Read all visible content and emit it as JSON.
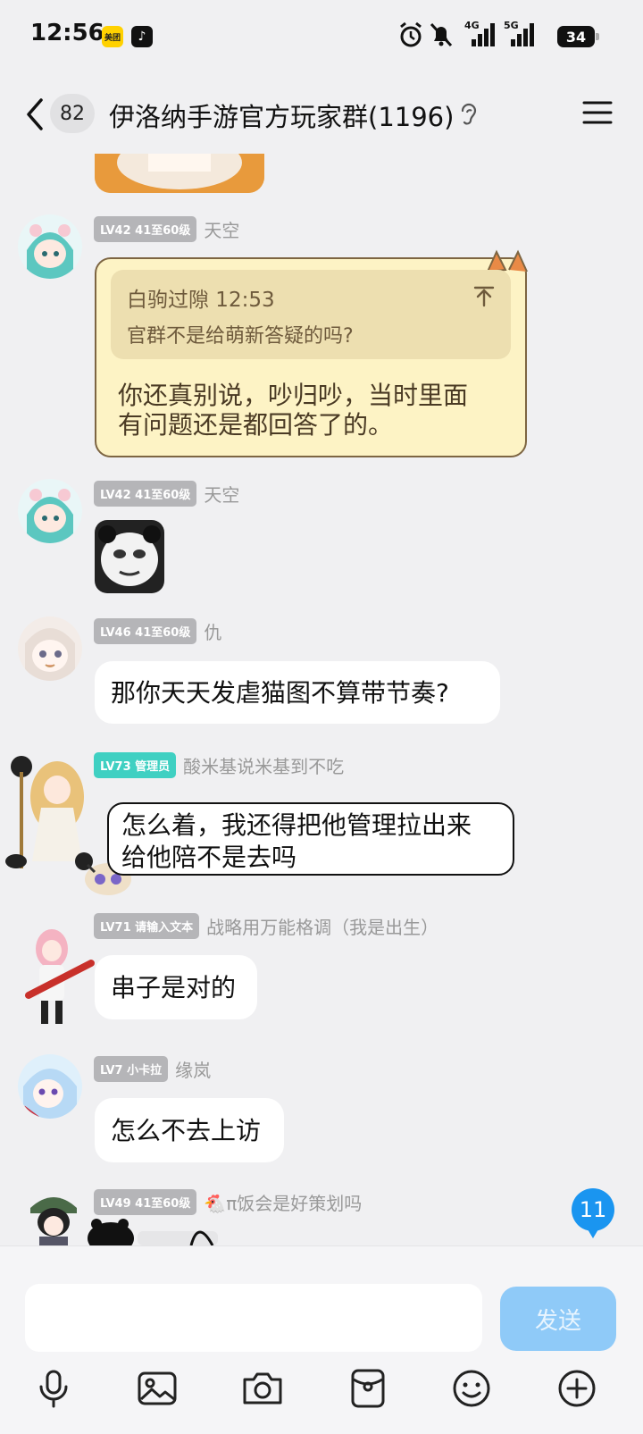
{
  "status_bar": {
    "time": "12:56",
    "app1": "美团",
    "app2": "♪",
    "net1": "4G",
    "net2": "5G",
    "battery": "34"
  },
  "header": {
    "unread": "82",
    "title": "伊洛纳手游官方玩家群(1196)"
  },
  "messages": [
    {
      "level": "LV42 41至60级",
      "name": "天空",
      "quote_header": "白驹过隙 12:53",
      "quote_text": "官群不是给萌新答疑的吗?",
      "line1": "你还真别说，吵归吵，当时里面",
      "line2": "有问题还是都回答了的。"
    },
    {
      "level": "LV42 41至60级",
      "name": "天空"
    },
    {
      "level": "LV46 41至60级",
      "name": "仇",
      "text": "那你天天发虐猫图不算带节奏?"
    },
    {
      "level": "LV73 管理员",
      "name": "酸米基说米基到不吃",
      "line1": "怎么着，我还得把他管理拉出来",
      "line2": "给他陪不是去吗"
    },
    {
      "level": "LV71 请输入文本",
      "name": "战略用万能格调（我是出生）",
      "text": "串子是对的"
    },
    {
      "level": "LV7 小卡拉",
      "name": "缘岚",
      "text": "怎么不去上访"
    },
    {
      "level": "LV49 41至60级",
      "name": "🐔π饭会是好策划吗"
    }
  ],
  "floating_badge": "11",
  "input": {
    "value": "",
    "placeholder": "",
    "send_label": "发送"
  },
  "toolbar": [
    "microphone-icon",
    "image-icon",
    "camera-icon",
    "red-packet-icon",
    "emoji-icon",
    "plus-icon"
  ],
  "colors": {
    "accent": "#1a95f0",
    "send_disabled": "#8fcaf8",
    "admin_badge": "#3fd0c2",
    "level_badge": "#b5b5b8"
  }
}
